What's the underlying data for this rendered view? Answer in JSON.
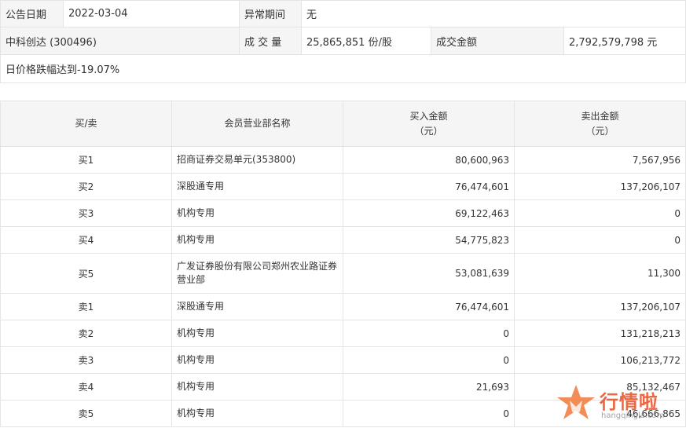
{
  "info": {
    "date_label": "公告日期",
    "date_value": "2022-03-04",
    "period_label": "异常期间",
    "period_value": "无",
    "stock": "中科创达 (300496)",
    "volume_label": "成 交 量",
    "volume_value": "25,865,851 份/股",
    "amount_label": "成交金额",
    "amount_value": "2,792,579,798 元",
    "reason": "日价格跌幅达到-19.07%"
  },
  "table": {
    "headers": {
      "side": "买/卖",
      "name": "会员营业部名称",
      "buy_line1": "买入金额",
      "buy_line2": "（元）",
      "sell_line1": "卖出金额",
      "sell_line2": "（元）"
    },
    "rows": [
      {
        "side": "买1",
        "name": "招商证券交易单元(353800)",
        "buy": "80,600,963",
        "sell": "7,567,956"
      },
      {
        "side": "买2",
        "name": "深股通专用",
        "buy": "76,474,601",
        "sell": "137,206,107"
      },
      {
        "side": "买3",
        "name": "机构专用",
        "buy": "69,122,463",
        "sell": "0"
      },
      {
        "side": "买4",
        "name": "机构专用",
        "buy": "54,775,823",
        "sell": "0"
      },
      {
        "side": "买5",
        "name": "广发证券股份有限公司郑州农业路证券营业部",
        "buy": "53,081,639",
        "sell": "11,300"
      },
      {
        "side": "卖1",
        "name": "深股通专用",
        "buy": "76,474,601",
        "sell": "137,206,107"
      },
      {
        "side": "卖2",
        "name": "机构专用",
        "buy": "0",
        "sell": "131,218,213"
      },
      {
        "side": "卖3",
        "name": "机构专用",
        "buy": "0",
        "sell": "106,213,772"
      },
      {
        "side": "卖4",
        "name": "机构专用",
        "buy": "21,693",
        "sell": "85,132,467"
      },
      {
        "side": "卖5",
        "name": "机构专用",
        "buy": "0",
        "sell": "46,666,865"
      }
    ]
  },
  "watermark": {
    "text": "行情啦",
    "sub": "hangqingla.com",
    "color": "#e8532a"
  }
}
